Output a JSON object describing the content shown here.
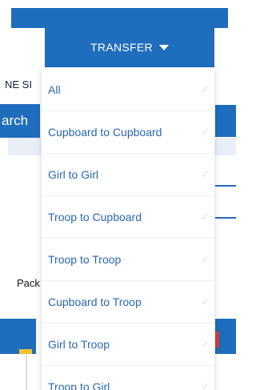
{
  "background": {
    "label_partial": "NE SI",
    "search_partial": "arch",
    "pack_partial": "Pack"
  },
  "dropdown": {
    "label": "TRANSFER",
    "caret_icon": "caret-down-icon",
    "check_icon": "check-icon",
    "items": [
      {
        "label": "All",
        "checked": false
      },
      {
        "label": "Cupboard to Cupboard",
        "checked": false
      },
      {
        "label": "Girl to Girl",
        "checked": false
      },
      {
        "label": "Troop to Cupboard",
        "checked": false
      },
      {
        "label": "Troop to Troop",
        "checked": false
      },
      {
        "label": "Cupboard to Troop",
        "checked": false
      },
      {
        "label": "Girl to Troop",
        "checked": false
      },
      {
        "label": "Troop to Girl",
        "checked": false
      }
    ]
  },
  "colors": {
    "primary": "#1f6dbd",
    "menu_text": "#2b67b3",
    "check_muted": "#e0e3e7",
    "accent_yellow": "#f2c12e",
    "accent_red": "#d93b3b"
  }
}
